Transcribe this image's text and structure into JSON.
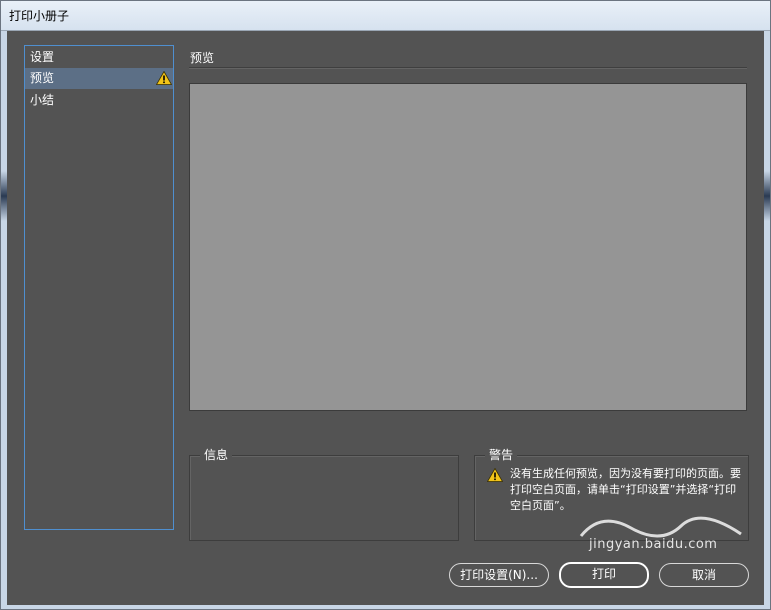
{
  "window": {
    "title": "打印小册子"
  },
  "nav": {
    "items": [
      {
        "label": "设置"
      },
      {
        "label": "预览"
      },
      {
        "label": "小结"
      }
    ]
  },
  "preview": {
    "title": "预览"
  },
  "info": {
    "title": "信息"
  },
  "warnings": {
    "title": "警告",
    "message": "没有生成任何预览，因为没有要打印的页面。要打印空白页面，请单击“打印设置”并选择“打印空白页面”。"
  },
  "buttons": {
    "print_setup": "打印设置(N)...",
    "print": "打印",
    "cancel": "取消"
  },
  "watermark": {
    "text": "jingyan.baidu.com"
  },
  "colors": {
    "panel_bg": "#535353",
    "selected_bg": "#5c6f86",
    "focus_border": "#4f8fd0",
    "warning_yellow": "#f2c418"
  }
}
